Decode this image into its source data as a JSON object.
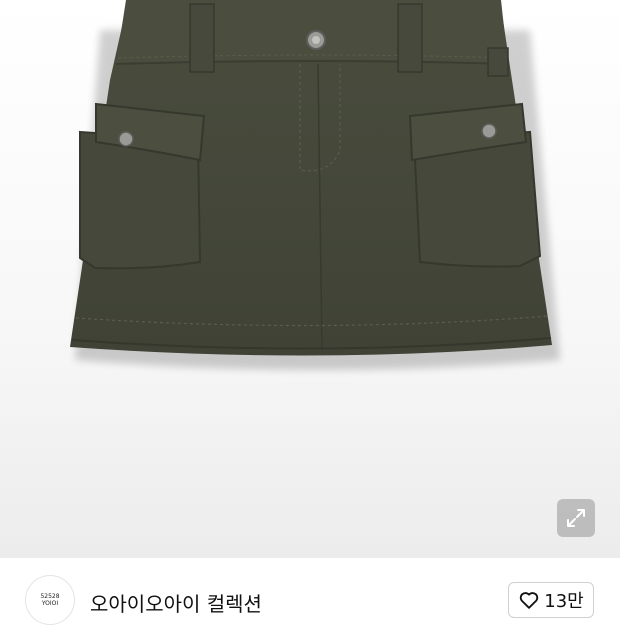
{
  "product": {
    "image_description": "olive khaki cargo mini skirt",
    "image_color": "#45483a"
  },
  "expand_icon": "expand-arrows-icon",
  "shop": {
    "avatar_line1": "52528",
    "avatar_line2": "YOIOI",
    "name": "오아이오아이 컬렉션"
  },
  "like": {
    "icon": "heart-outline-icon",
    "count": "13만"
  }
}
